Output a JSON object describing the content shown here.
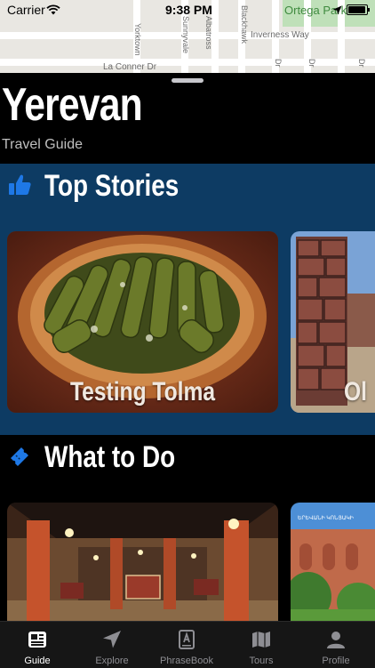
{
  "status_bar": {
    "carrier": "Carrier",
    "time": "9:38 PM"
  },
  "map": {
    "streets": [
      "Inverness Way",
      "La Conner Dr",
      "Sunnyvale",
      "Albatross",
      "Blackhawk",
      "Yorktown",
      "Dr"
    ],
    "park": "Ortega Park"
  },
  "header": {
    "title": "Yerevan",
    "subtitle": "Travel Guide"
  },
  "sections": {
    "top_stories": {
      "title": "Top Stories",
      "icon": "thumbs-up-icon",
      "cards": [
        {
          "label": "Testing Tolma"
        },
        {
          "label": "Ol"
        }
      ]
    },
    "what_to_do": {
      "title": "What to Do",
      "icon": "ticket-icon",
      "cards": [
        {
          "label": ""
        },
        {
          "label": "ԵՐԵՎԱՆԻ ԿՈՆՅԱԿԻ"
        }
      ]
    }
  },
  "tabbar": {
    "items": [
      {
        "label": "Guide",
        "icon": "guide-icon",
        "active": true
      },
      {
        "label": "Explore",
        "icon": "location-arrow-icon",
        "active": false
      },
      {
        "label": "PhraseBook",
        "icon": "phrasebook-icon",
        "active": false
      },
      {
        "label": "Tours",
        "icon": "map-icon",
        "active": false
      },
      {
        "label": "Profile",
        "icon": "profile-icon",
        "active": false
      }
    ]
  },
  "colors": {
    "accent": "#1e78e6",
    "section_bg": "#0d3b63"
  }
}
